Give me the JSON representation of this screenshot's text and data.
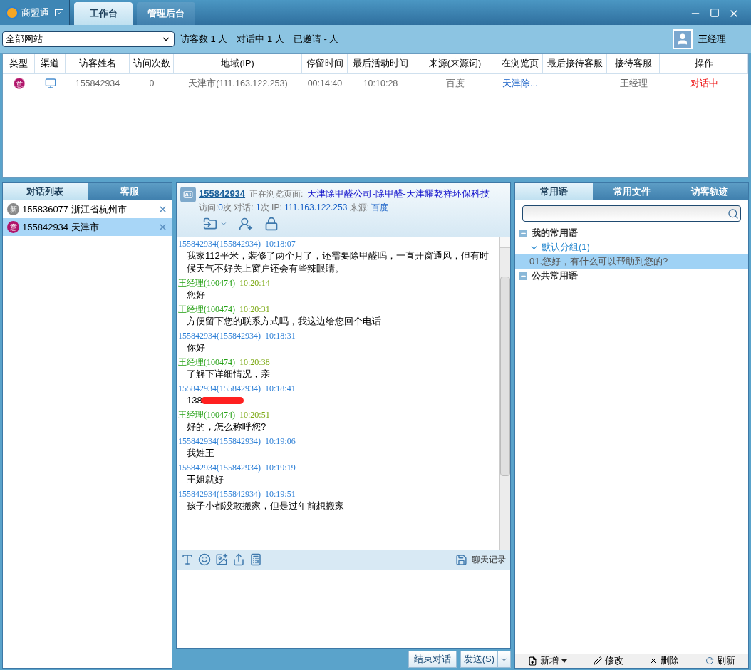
{
  "app": {
    "name": "商盟通"
  },
  "tabs": [
    {
      "label": "工作台",
      "selected": true
    },
    {
      "label": "管理后台",
      "selected": false
    }
  ],
  "toolbar": {
    "site_select": "全部网站",
    "stats": "访客数 1 人　对话中 1 人　已邀请 - 人",
    "user": "王经理"
  },
  "table": {
    "columns": [
      "类型",
      "渠道",
      "访客姓名",
      "访问次数",
      "地域(IP)",
      "停留时间",
      "最后活动时间",
      "来源(来源词)",
      "在浏览页",
      "最后接待客服",
      "接待客服",
      "操作"
    ],
    "rows": [
      {
        "badge": "意",
        "name": "155842934",
        "visits": "0",
        "region": "天津市(111.163.122.253)",
        "stay": "00:14:40",
        "last_active": "10:10:28",
        "source": "百度",
        "page": "天津除...",
        "last_agent": "",
        "agent": "王经理",
        "action": "对话中"
      }
    ]
  },
  "left_panel": {
    "tabs": [
      {
        "label": "对话列表",
        "selected": true
      },
      {
        "label": "客服",
        "selected": false
      }
    ],
    "items": [
      {
        "badge": "新",
        "kind": "new",
        "text": "155836077 浙江省杭州市",
        "selected": false
      },
      {
        "badge": "意",
        "kind": "intent",
        "text": "155842934 天津市",
        "selected": true
      }
    ]
  },
  "chat": {
    "visitor": "155842934",
    "browsing_label": "正在浏览页面:",
    "browsing_page": "天津除甲醛公司-除甲醛-天津耀乾祥环保科技",
    "info": [
      {
        "label": "访问:",
        "value": "0"
      },
      {
        "label": "次 对话:",
        "value": "1"
      },
      {
        "label": "次 IP:",
        "value": "111.163.122.253"
      },
      {
        "label": "来源:",
        "value": "百度"
      }
    ],
    "messages": [
      {
        "kind": "visitor",
        "sender": "155842934(155842934)",
        "time": "10:18:07",
        "text": "我家112平米，装修了两个月了，还需要除甲醛吗，一直开窗通风，但有时候天气不好关上窗户还会有些辣眼睛。"
      },
      {
        "kind": "agent",
        "sender": "王经理(100474)",
        "time": "10:20:14",
        "text": "您好"
      },
      {
        "kind": "agent",
        "sender": "王经理(100474)",
        "time": "10:20:31",
        "text": "方便留下您的联系方式吗，我这边给您回个电话"
      },
      {
        "kind": "visitor",
        "sender": "155842934(155842934)",
        "time": "10:18:31",
        "text": "你好"
      },
      {
        "kind": "agent",
        "sender": "王经理(100474)",
        "time": "10:20:38",
        "text": "了解下详细情况，亲"
      },
      {
        "kind": "visitor",
        "sender": "155842934(155842934)",
        "time": "10:18:41",
        "text": "138",
        "redacted": true
      },
      {
        "kind": "agent",
        "sender": "王经理(100474)",
        "time": "10:20:51",
        "text": "好的，怎么称呼您?"
      },
      {
        "kind": "visitor",
        "sender": "155842934(155842934)",
        "time": "10:19:06",
        "text": "我姓王"
      },
      {
        "kind": "visitor",
        "sender": "155842934(155842934)",
        "time": "10:19:19",
        "text": "王姐就好"
      },
      {
        "kind": "visitor",
        "sender": "155842934(155842934)",
        "time": "10:19:51",
        "text": "孩子小都没敢搬家，但是过年前想搬家"
      }
    ],
    "history": "聊天记录",
    "end_button": "结束对话",
    "send_button": "发送(S)"
  },
  "right_panel": {
    "tabs": [
      {
        "label": "常用语",
        "selected": true
      },
      {
        "label": "常用文件",
        "selected": false
      },
      {
        "label": "访客轨迹",
        "selected": false
      }
    ],
    "tree": [
      {
        "label": "我的常用语",
        "expanded": true,
        "children": [
          {
            "label": "默认分组(1)",
            "expanded": true,
            "children": [
              {
                "label": "01.您好，有什么可以帮助到您的?",
                "selected": true
              }
            ]
          }
        ]
      },
      {
        "label": "公共常用语",
        "expanded": true
      }
    ],
    "actions": [
      "新增",
      "修改",
      "删除",
      "刷新"
    ]
  }
}
